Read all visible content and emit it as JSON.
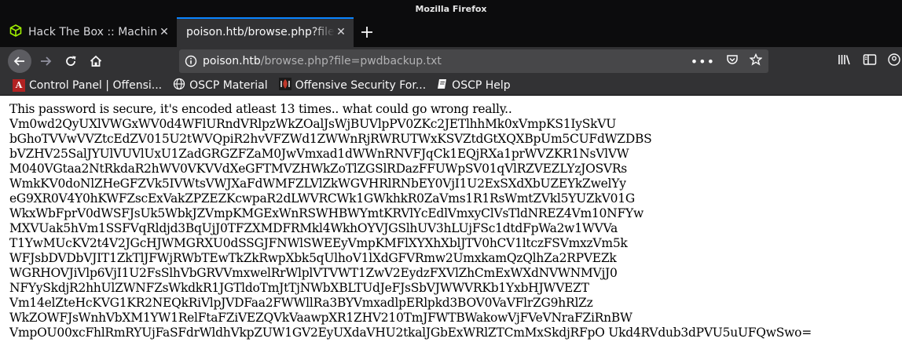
{
  "window": {
    "title": "Mozilla Firefox"
  },
  "tabs": [
    {
      "title": "Hack The Box :: Machines",
      "active": false
    },
    {
      "title": "poison.htb/browse.php?file=pwdbackup.txt",
      "active": true
    }
  ],
  "nav": {
    "url_host": "poison.htb",
    "url_path": "/browse.php?file=pwdbackup.txt"
  },
  "bookmarks": [
    {
      "label": "Control Panel | Offensi...",
      "icon": "red-logo-icon"
    },
    {
      "label": "OSCP Material",
      "icon": "globe-icon"
    },
    {
      "label": "Offensive Security For...",
      "icon": "offsec-icon"
    },
    {
      "label": "OSCP Help",
      "icon": "note-icon"
    }
  ],
  "content": {
    "lines": [
      "This password is secure, it's encoded atleast 13 times.. what could go wrong really..",
      "Vm0wd2QyUXlVWGxWV0d4WFlURndVRlpzWkZOalJsWjBUVlpPV0ZKc2JETlhhMk0xVmpKS1IySkVU",
      "bGhoTVVwVVZtcEdZV015U2tWVQpiR2hvVFZWd1ZWWnRjRWRUTWxKSVZtdGtXQXBpUm5CUFdWZDBS",
      "bVZHV25SalJYUlVUVlUxU1ZadGRGZFZaM0JwVmxad1dWWnRNVFJqCk1EQjRXa1prWVZKR1NsVlVW",
      "M040VGtaa2NtRkdaR2hWV0VKVVdXeGFTMVZHWkZoTlZGSlRDazFFUWpSV01qVlRZVEZLYzJOSVRs",
      "WmkKV0doNlZHeGFZVk5IVWtsVWJXaFdWMFZLVlZkWGVHRlRNbEY0VjI1U2ExSXdXbUZEYkZwelYy",
      "eG9XR0V4Y0hKWFZscExVakZPZEZKcwpaR2dLWVRCWk1GWkhkR0ZaVms1R1RsWmtZVkl5YUZkV01G",
      "WkxWbFprV0dWSFJsUk5WbkJZVmpKMGExWnRSWHBWYmtKRVlYcEdlVmxyClVsTldNREZ4Vm10NFYw",
      "MXVUak5hVm1SSFVqRldjd3BqUjJ0TFZXMDFRMkl4WkhOYVJGSlhUV3hLUjFSc1dtdFpWa2w1WVVa",
      "T1YwMUcKV2t4V2JGcHJWMGRXU0dSSGJFNWlSWEEyVmpKMFlXYXhXblJTV0hCV1ltczFSVmxzVm5k",
      "WFJsbDVDbVJIT1ZkTlJFWjRWbTEwTkZkRwpXbk5qUlhoV1lXdGFVRmw2UmxkamQzQlhZa2RPVEZk",
      "WGRHOVJiVlp6VjI1U2FsSlhVbGRVVmxwelRrWlplVTVWT1ZwV2EydzFXVlZhCmExWXdNVWNMVjJ0",
      "NFYySkdjR2hhUlZWNFZsWkdkR1JGTldoTmJtTjNWbXBLTUdJeFJsSbVJWWVRKb1YxbHJWVEZT",
      "Vm14elZteHcKVG1KR2NEQkRiVlpJVDFaa2FWWllRa3BYVmxadlpERlpkd3BOV0VaVFlrZG9hRlZz",
      "WkZOWFJsWnhVbXM1YW1RelFtaFZiVEZQVkVaawpXR1ZHV210TmJFWTBWakowVjFVeVNraFZiRnBW",
      "VmpOU00xcFhlRmRYUjFaSFdrWldhVkpZUW1GV2EyUXdaVHU2tkalJGbExWRlZTCmMxSkdjRFpO Ukd4RVdub3dPVU5uUFQwSwo="
    ]
  }
}
